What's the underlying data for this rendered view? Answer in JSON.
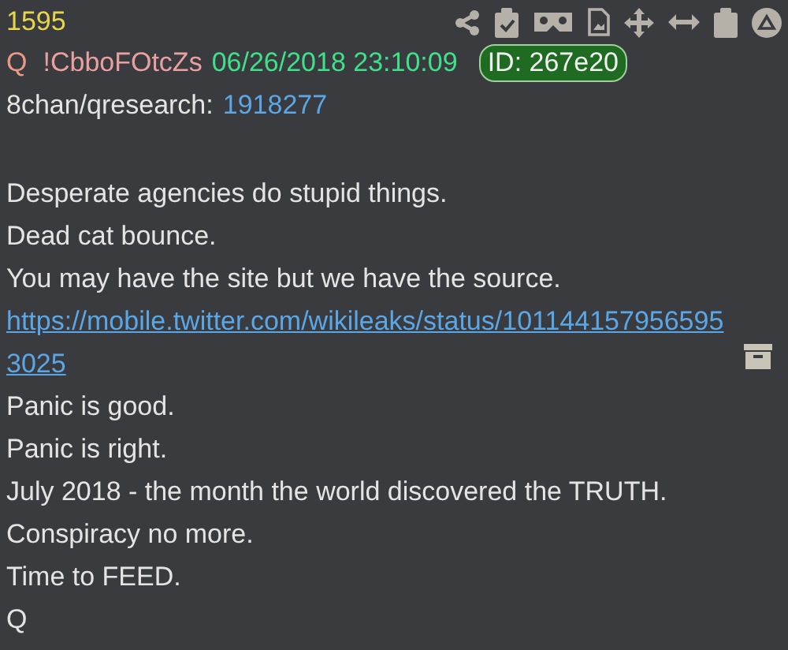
{
  "post": {
    "number": "1595",
    "author": "Q",
    "tripcode": "!CbboFOtcZs",
    "timestamp": "06/26/2018 23:10:09",
    "id_badge": "ID: 267e20",
    "board": "8chan/qresearch:",
    "thread": "1918277"
  },
  "toolbar": [
    {
      "kind": "share"
    },
    {
      "kind": "clipboard-check"
    },
    {
      "kind": "goggles"
    },
    {
      "kind": "document"
    },
    {
      "kind": "move"
    },
    {
      "kind": "resize"
    },
    {
      "kind": "clipboard"
    },
    {
      "kind": "top"
    }
  ],
  "body": [
    {
      "kind": "text",
      "text": "Desperate agencies do stupid things."
    },
    {
      "kind": "text",
      "text": "Dead cat bounce."
    },
    {
      "kind": "text",
      "text": "You may have the site but we have the source."
    },
    {
      "kind": "link",
      "text": "https://mobile.twitter.com/wikileaks/status/1011441579565953025"
    },
    {
      "kind": "text",
      "text": "Panic is good."
    },
    {
      "kind": "text",
      "text": "Panic is right."
    },
    {
      "kind": "text",
      "text": "July 2018 - the month the world discovered the TRUTH."
    },
    {
      "kind": "text",
      "text": "Conspiracy no more."
    },
    {
      "kind": "text",
      "text": "Time to FEED."
    },
    {
      "kind": "text",
      "text": "Q"
    }
  ]
}
